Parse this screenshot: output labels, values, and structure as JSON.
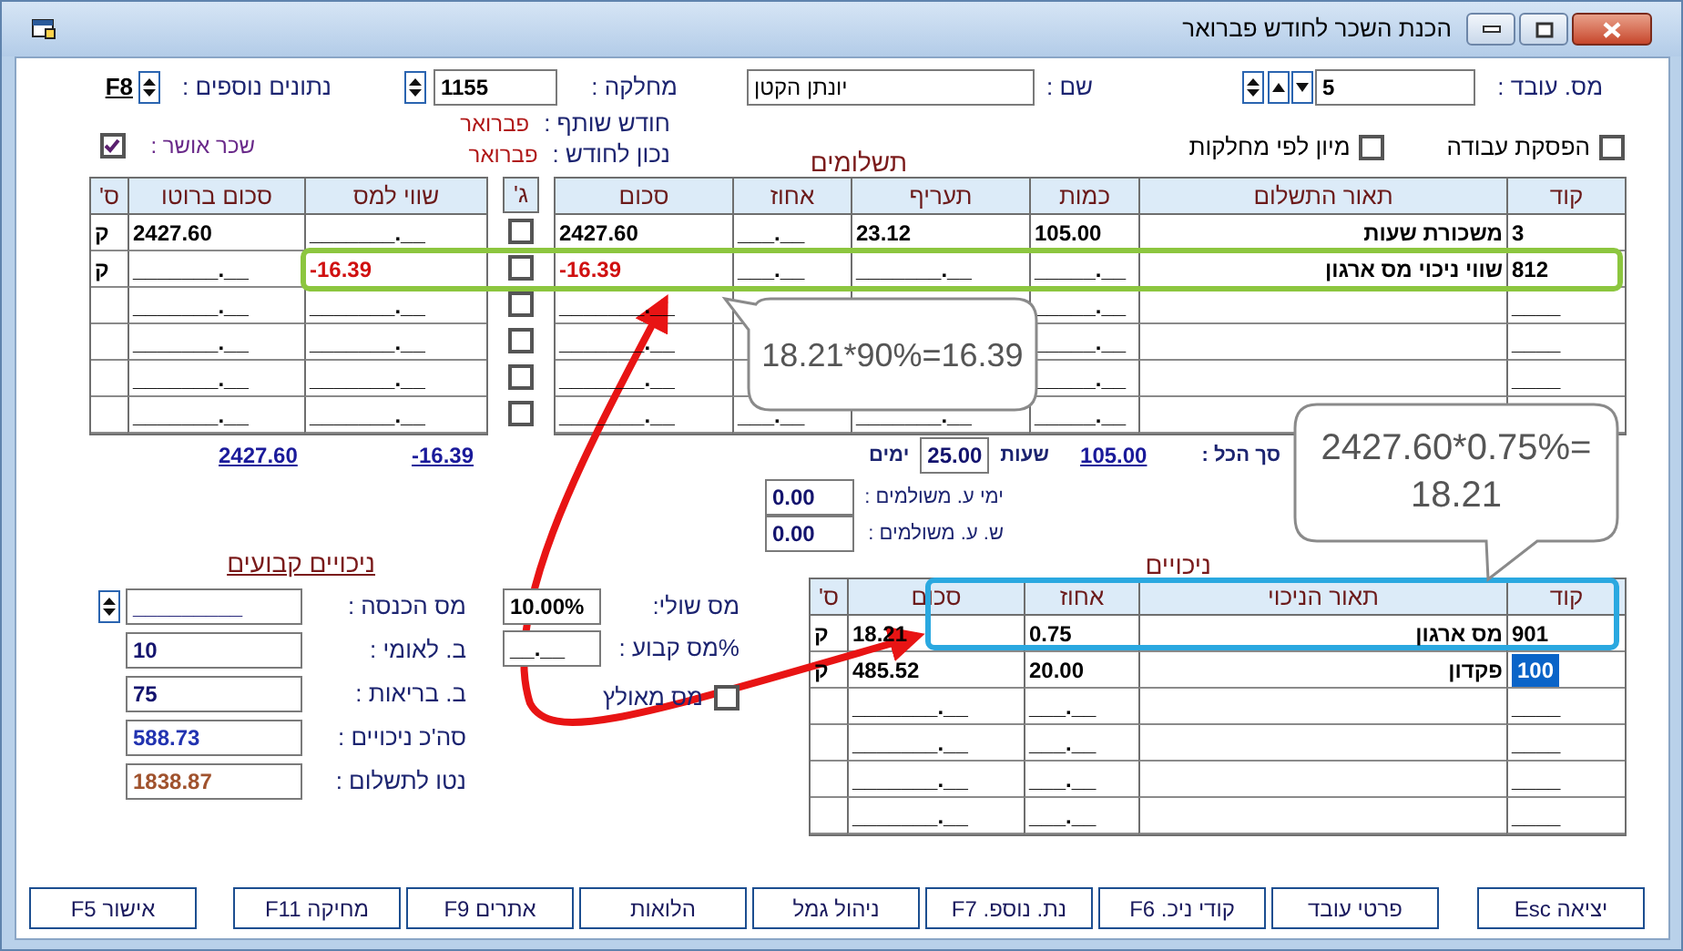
{
  "window": {
    "title": "הכנת השכר לחודש פברואר"
  },
  "employee": {
    "number_label": "מס. עובד :",
    "number": "5",
    "name_label": "שם :",
    "name": "יונתן הקטן",
    "department_label": "מחלקה :",
    "department": "1155",
    "extra_label": "נתונים נוספים :",
    "extra_key": "F8"
  },
  "months": [
    {
      "label": "חודש שותף :",
      "value": "פברואר"
    },
    {
      "label": "נכון לחודש :",
      "value": "פברואר"
    }
  ],
  "options": [
    {
      "label": "הפסקת עבודה",
      "checked": false
    },
    {
      "label": "מיון לפי מחלקות",
      "checked": false
    }
  ],
  "salary_approved": {
    "label": "שכר אושר :",
    "checked": true
  },
  "payments": {
    "title": "תשלומים",
    "columns": [
      "קוד",
      "תאור התשלום",
      "כמות",
      "תעריף",
      "אחוז",
      "סכום"
    ],
    "g_header": "ג'",
    "side_columns": [
      "שווי למס",
      "סכום ברוטו",
      "ס'"
    ],
    "rows": [
      {
        "code": "3",
        "description": "משכורת שעות",
        "quantity": "105.00",
        "rate": "23.12",
        "percent": "___.__",
        "amount": "2427.60",
        "negative": false,
        "checked": false,
        "taxable": "_______.__",
        "gross": "2427.60",
        "s": "ק"
      },
      {
        "code": "812",
        "description": "שווי ניכוי מס ארגון",
        "quantity": "_____.__",
        "rate": "_______.__",
        "percent": "___.__",
        "amount": "-16.39",
        "negative": true,
        "checked": false,
        "taxable": "-16.39",
        "gross": "_______.__",
        "s": "ק"
      },
      {
        "code": "____",
        "quantity": "_____.__",
        "amount": "_______.__",
        "negative": false,
        "checked": false,
        "taxable": "_______.__",
        "gross": "_______.__"
      },
      {
        "code": "____",
        "quantity": "_____.__",
        "amount": "_______.__",
        "negative": false,
        "checked": false,
        "taxable": "_______.__",
        "gross": "_______.__"
      },
      {
        "code": "____",
        "quantity": "_____.__",
        "amount": "_______.__",
        "negative": false,
        "checked": false,
        "taxable": "_______.__",
        "gross": "_______.__"
      },
      {
        "quantity": "_____.__",
        "rate": "_______.__",
        "percent": "___.__",
        "amount": "_______.__",
        "negative": false,
        "checked": false,
        "taxable": "_______.__",
        "gross": "_______.__"
      }
    ]
  },
  "totals": {
    "label": "סך הכל :",
    "hours": "105.00",
    "hours_label": "שעות",
    "days": "25.00",
    "days_label": "ימים",
    "taxable": "-16.39",
    "gross": "2427.60"
  },
  "paid_absence": [
    {
      "label": "ימי ע. משולמים :",
      "value": "0.00"
    },
    {
      "label": "ש. ע. משולמים :",
      "value": "0.00"
    }
  ],
  "deductions": {
    "title": "ניכויים",
    "columns": [
      "קוד",
      "תאור הניכוי",
      "אחוז",
      "סכום",
      "ס'"
    ],
    "rows": [
      {
        "code": "901",
        "description": "מס ארגון",
        "percent": "0.75",
        "amount": "18.21",
        "s": "ק",
        "selected": false
      },
      {
        "code": "100",
        "description": "פקדון",
        "percent": "20.00",
        "amount": "485.52",
        "s": "ק",
        "selected": true
      },
      {
        "code": "____",
        "percent": "___.__",
        "amount": "_______.__",
        "selected": false
      },
      {
        "code": "____",
        "percent": "___.__",
        "amount": "_______.__",
        "selected": false
      },
      {
        "code": "____",
        "percent": "___.__",
        "amount": "_______.__",
        "selected": false
      },
      {
        "code": "____",
        "percent": "___.__",
        "amount": "_______.__",
        "selected": false
      }
    ]
  },
  "fixed_deductions": {
    "title": "ניכויים קבועים",
    "fields": [
      {
        "label": "מס הכנסה :",
        "value": "_________",
        "kind": "spinner",
        "color": "#14146e"
      },
      {
        "label": "ב. לאומי :",
        "value": "10",
        "kind": "plain",
        "color": "#14146e"
      },
      {
        "label": "ב. בריאות :",
        "value": "75",
        "kind": "plain",
        "color": "#14146e"
      },
      {
        "label": "סה'כ ניכויים :",
        "value": "588.73",
        "kind": "plain",
        "color": "#2233b0"
      },
      {
        "label": "נטו לתשלום :",
        "value": "1838.87",
        "kind": "plain",
        "color": "#a0522d"
      }
    ]
  },
  "tax": {
    "marginal_label": "מס שולי:",
    "marginal": "10.00%",
    "fixed_label": "%מס קבוע :",
    "fixed": "__.__",
    "forced_label": "מס מאולץ",
    "forced": false
  },
  "buttons": [
    "יציאה Esc",
    "פרטי עובד",
    "קודי ניכ. F6",
    "נת. נוספ. F7",
    "ניהול גמל",
    "הלואות",
    "אתרים F9",
    "מחיקה F11",
    "אישור F5"
  ],
  "callouts": [
    {
      "lines": [
        "18.21*90%=16.39"
      ]
    },
    {
      "lines": [
        "2427.60*0.75%=",
        "18.21"
      ]
    }
  ]
}
